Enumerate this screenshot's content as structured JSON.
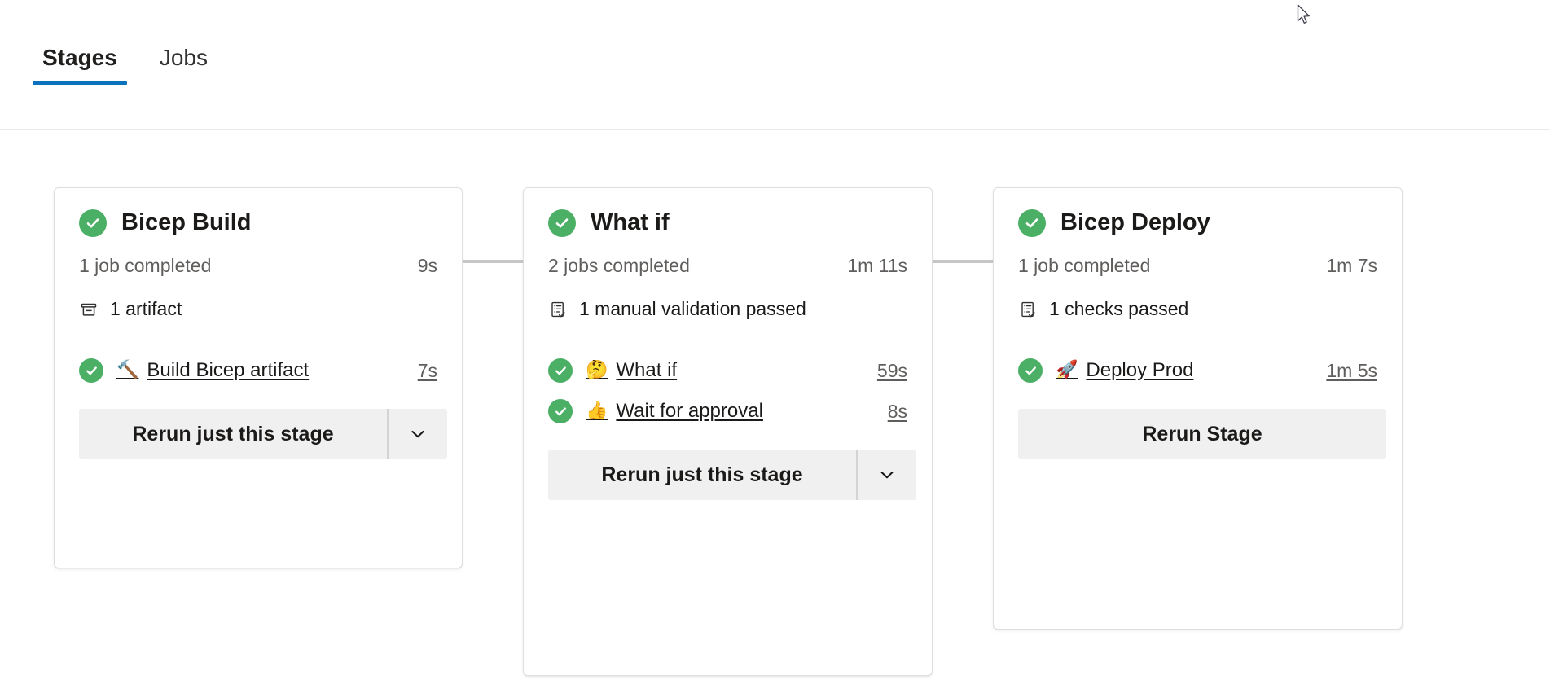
{
  "tabs": [
    {
      "label": "Stages",
      "active": true
    },
    {
      "label": "Jobs",
      "active": false
    }
  ],
  "colors": {
    "accent": "#0b72bd",
    "success": "#4caf66",
    "card_border": "#e1dfdd",
    "button_bg": "#f0f0f0",
    "connector": "#c8c6c4",
    "muted_text": "#605e5c"
  },
  "stages": [
    {
      "name": "Bicep Build",
      "status": "succeeded",
      "summary": "1 job completed",
      "duration": "9s",
      "meta": {
        "icon": "artifact-icon",
        "label": "1 artifact"
      },
      "jobs": [
        {
          "name": "Build Bicep artifact",
          "emoji": "🔨",
          "emoji_name": "hammer-emoji",
          "duration": "7s",
          "status": "succeeded"
        }
      ],
      "button": {
        "type": "split",
        "label": "Rerun just this stage",
        "chevron": "chevron-down-icon"
      }
    },
    {
      "name": "What if",
      "status": "succeeded",
      "summary": "2 jobs completed",
      "duration": "1m 11s",
      "meta": {
        "icon": "checks-icon",
        "label": "1 manual validation passed"
      },
      "jobs": [
        {
          "name": "What if",
          "emoji": "🤔",
          "emoji_name": "thinking-face-emoji",
          "duration": "59s",
          "status": "succeeded"
        },
        {
          "name": "Wait for approval",
          "emoji": "👍",
          "emoji_name": "thumbs-up-emoji",
          "duration": "8s",
          "status": "succeeded"
        }
      ],
      "button": {
        "type": "split",
        "label": "Rerun just this stage",
        "chevron": "chevron-down-icon"
      }
    },
    {
      "name": "Bicep Deploy",
      "status": "succeeded",
      "summary": "1 job completed",
      "duration": "1m 7s",
      "meta": {
        "icon": "checks-icon",
        "label": "1 checks passed"
      },
      "jobs": [
        {
          "name": "Deploy Prod",
          "emoji": "🚀",
          "emoji_name": "rocket-emoji",
          "duration": "1m 5s",
          "status": "succeeded"
        }
      ],
      "button": {
        "type": "plain",
        "label": "Rerun Stage"
      }
    }
  ]
}
